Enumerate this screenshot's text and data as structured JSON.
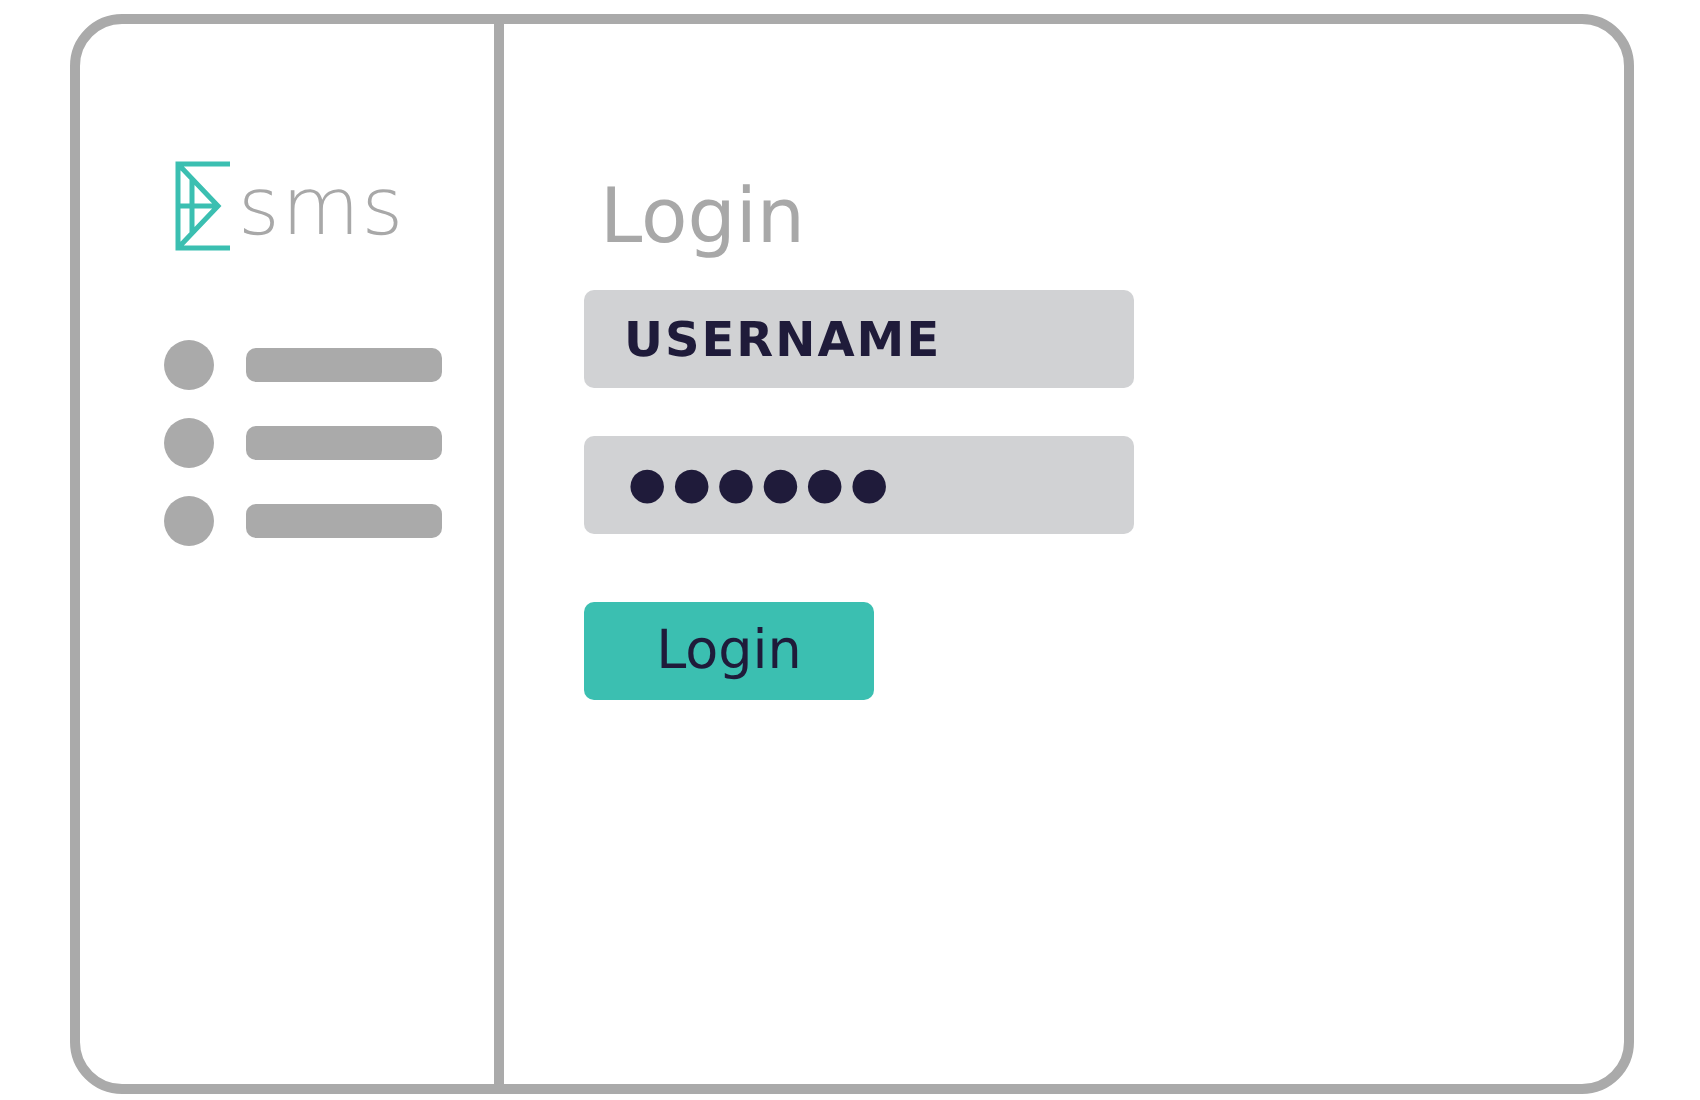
{
  "sidebar": {
    "logo_text": "sms"
  },
  "login_form": {
    "title": "Login",
    "username": {
      "value": "USERNAME"
    },
    "password": {
      "value": "●●●●●●"
    },
    "submit_button": "Login"
  }
}
